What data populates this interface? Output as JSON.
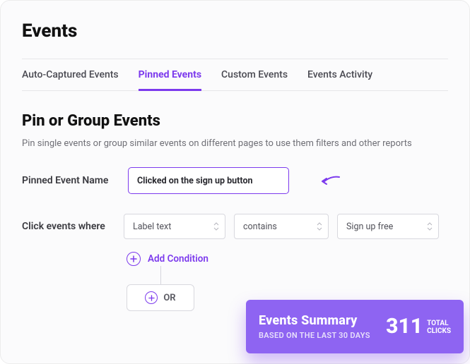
{
  "page_title": "Events",
  "tabs": [
    {
      "label": "Auto-Captured Events",
      "active": false
    },
    {
      "label": "Pinned Events",
      "active": true
    },
    {
      "label": "Custom Events",
      "active": false
    },
    {
      "label": "Events Activity",
      "active": false
    }
  ],
  "section": {
    "title": "Pin or Group Events",
    "description": "Pin single events or group similar events on different pages to use them filters and other reports",
    "name_label": "Pinned Event Name",
    "name_value": "Clicked on the sign up button",
    "filter_label": "Click events where",
    "filter": {
      "field": "Label text",
      "operator": "contains",
      "value": "Sign up free"
    },
    "add_condition_label": "Add Condition",
    "or_label": "OR"
  },
  "summary_card": {
    "title": "Events Summary",
    "subtitle": "BASED ON THE LAST 30 DAYS",
    "count": "311",
    "unit_line1": "TOTAL",
    "unit_line2": "CLICKS"
  }
}
